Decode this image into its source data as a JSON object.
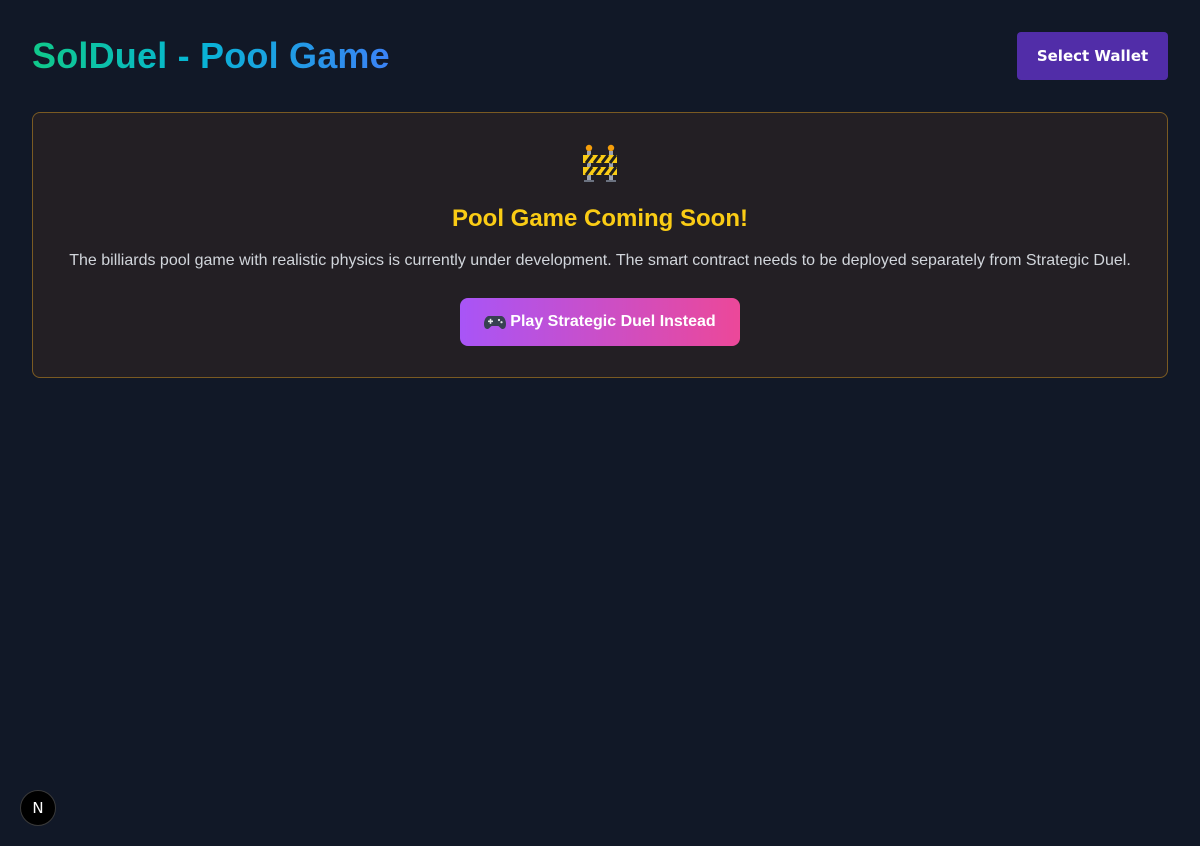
{
  "header": {
    "title": "SolDuel - Pool Game",
    "wallet_button_label": "Select Wallet"
  },
  "notice": {
    "icon": "construction-barrier-icon",
    "title": "Pool Game Coming Soon!",
    "message": "The billiards pool game with realistic physics is currently under development. The smart contract needs to be deployed separately from Strategic Duel.",
    "action_icon": "gamepad-icon",
    "action_label": "Play Strategic Duel Instead"
  },
  "dev_badge": {
    "label": "N",
    "icon": "nextjs-logo-icon"
  },
  "colors": {
    "background": "#111827",
    "wallet_button": "#512da8",
    "notice_title": "#facc15",
    "notice_border": "#7a5a22",
    "action_gradient_start": "#a855f7",
    "action_gradient_end": "#ec4899"
  }
}
